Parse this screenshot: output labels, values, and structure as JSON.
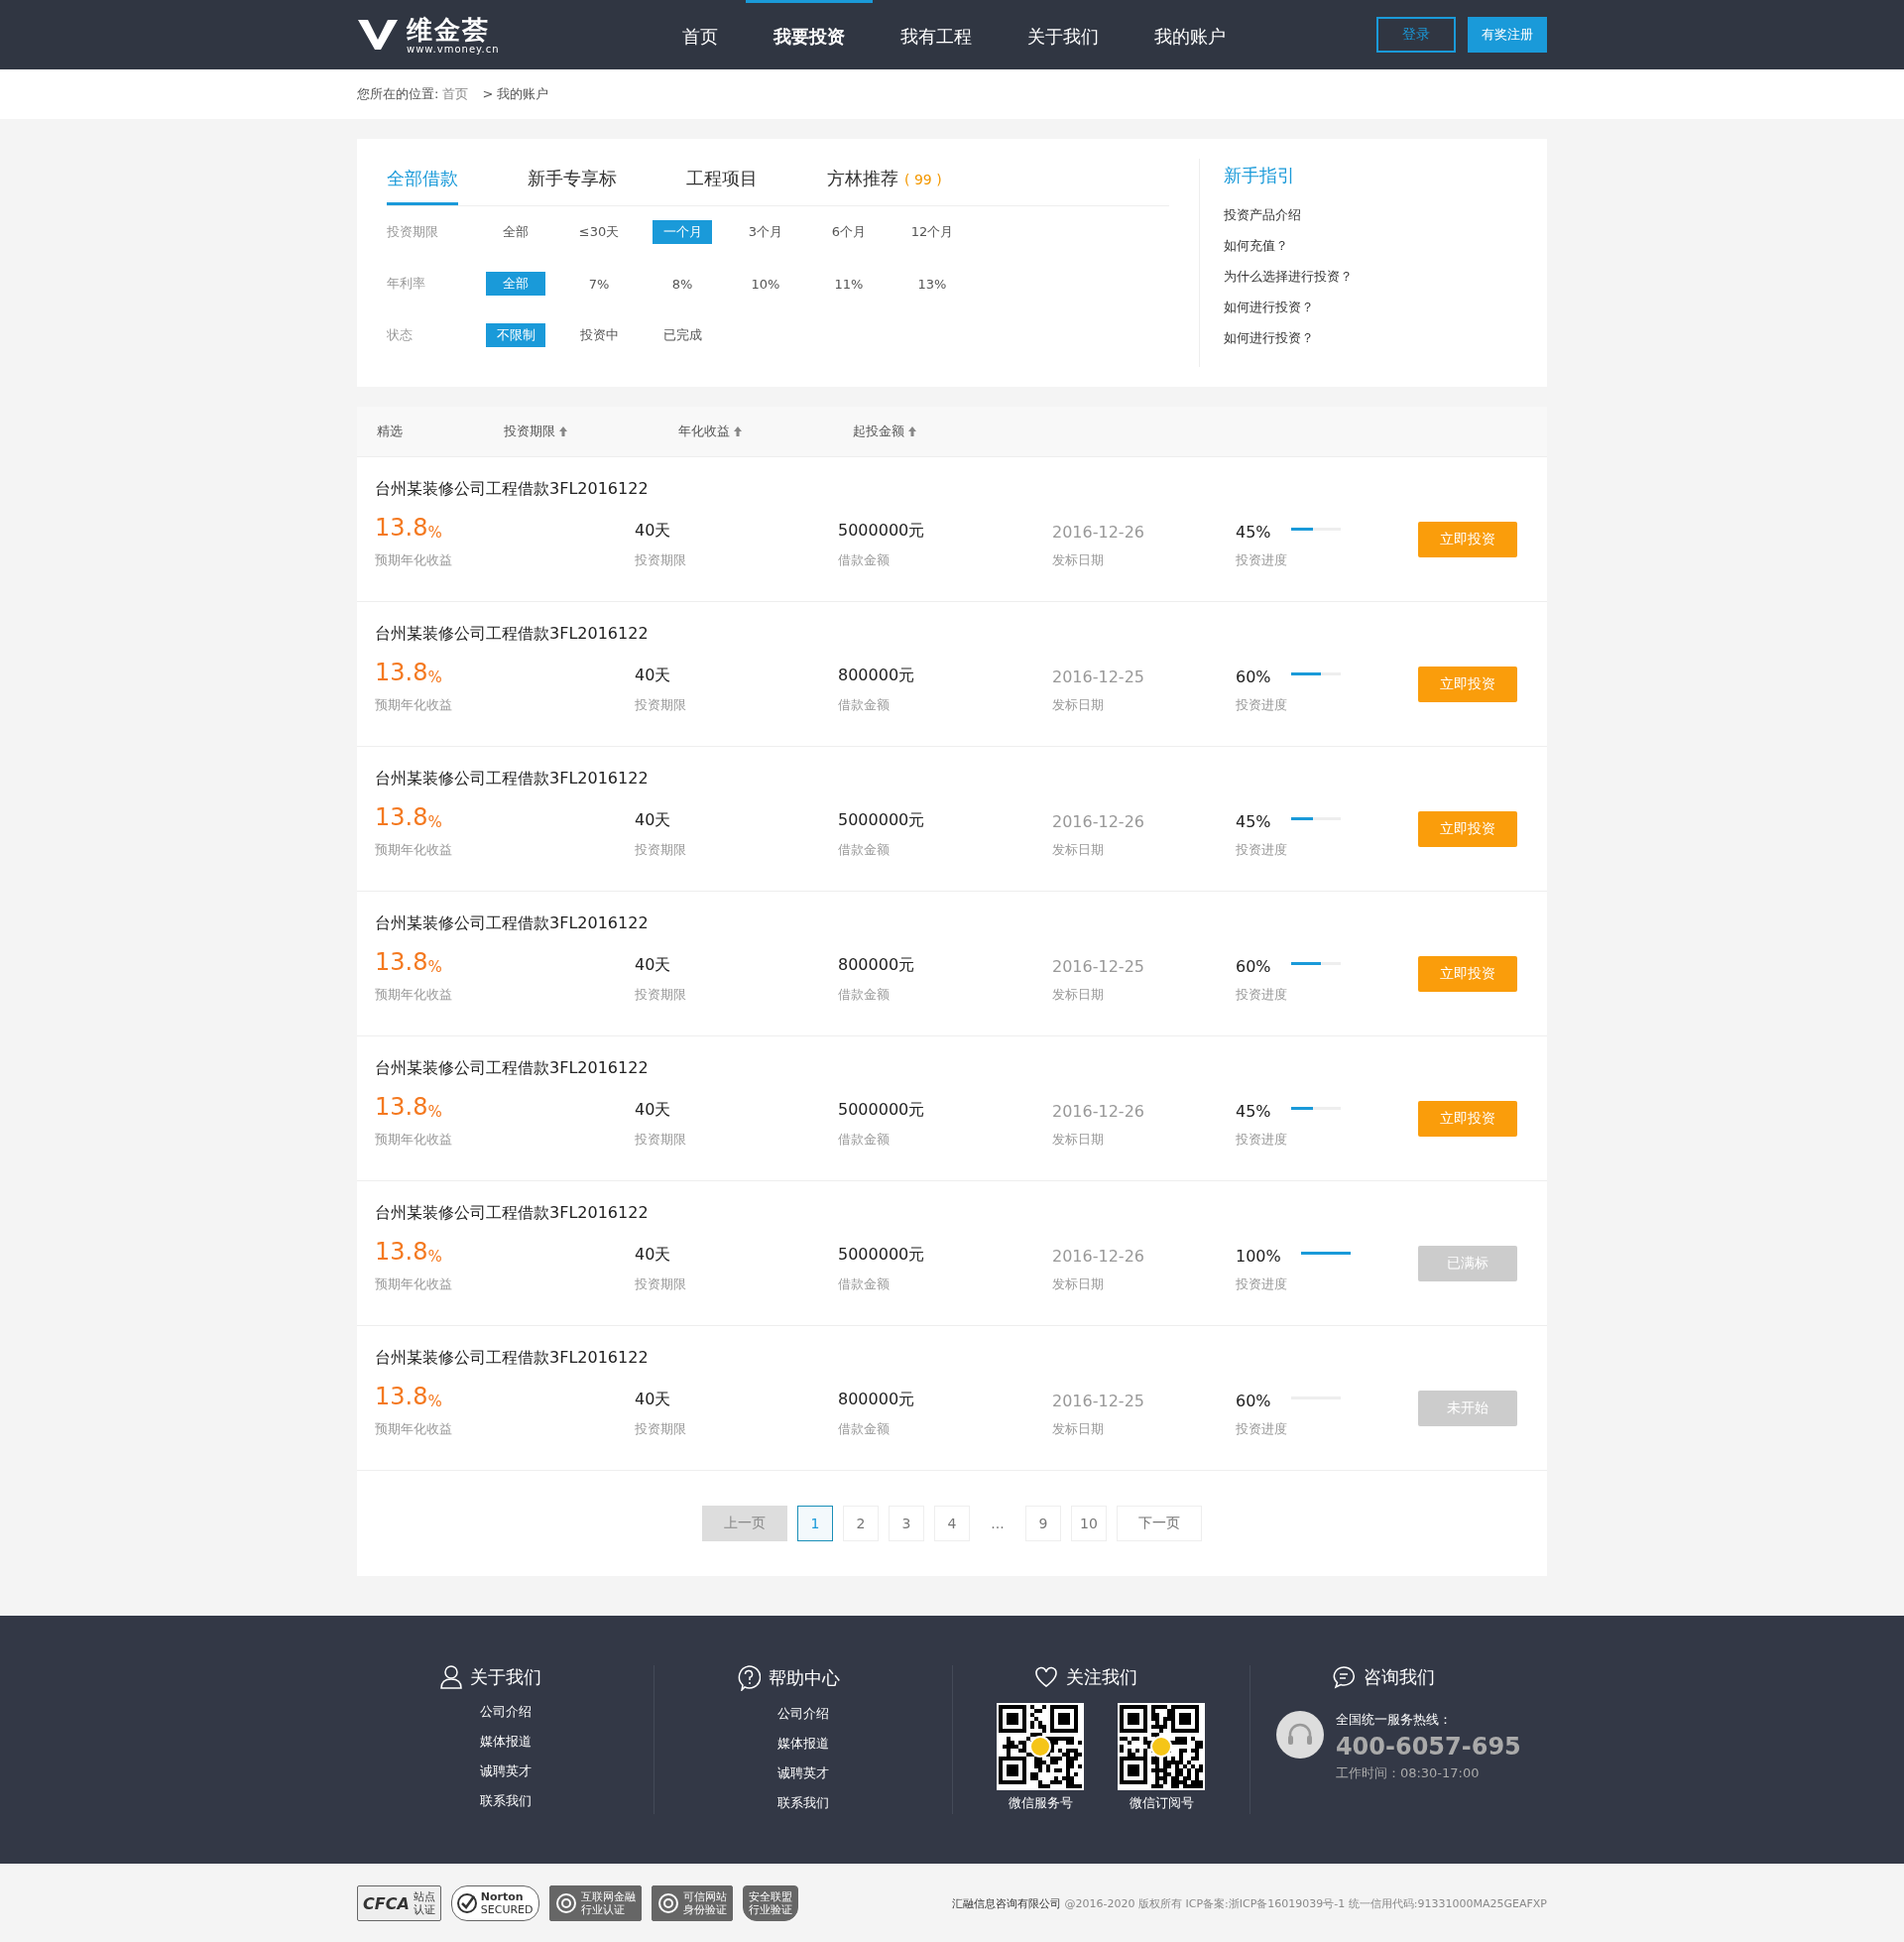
{
  "header": {
    "logo": {
      "name": "维金荟",
      "url": "www.vmoney.cn"
    },
    "nav": [
      {
        "label": "首页",
        "selected": false
      },
      {
        "label": "我要投资",
        "selected": true
      },
      {
        "label": "我有工程",
        "selected": false
      },
      {
        "label": "关于我们",
        "selected": false
      },
      {
        "label": "我的账户",
        "selected": false
      }
    ],
    "login": "登录",
    "register": "有奖注册"
  },
  "breadcrumb": {
    "prefix": "您所在的位置:",
    "home": "首页",
    "current": "> 我的账户"
  },
  "tabs": [
    {
      "label": "全部借款",
      "selected": true
    },
    {
      "label": "新手专享标",
      "selected": false
    },
    {
      "label": "工程项目",
      "selected": false
    },
    {
      "label": "方林推荐",
      "count": "( 99 )",
      "selected": false
    }
  ],
  "filters": [
    {
      "label": "投资期限",
      "options": [
        {
          "label": "全部",
          "selected": false
        },
        {
          "label": "≤30天",
          "selected": false
        },
        {
          "label": "一个月",
          "selected": true
        },
        {
          "label": "3个月",
          "selected": false
        },
        {
          "label": "6个月",
          "selected": false
        },
        {
          "label": "12个月",
          "selected": false
        }
      ]
    },
    {
      "label": "年利率",
      "options": [
        {
          "label": "全部",
          "selected": true
        },
        {
          "label": "7%",
          "selected": false
        },
        {
          "label": "8%",
          "selected": false
        },
        {
          "label": "10%",
          "selected": false
        },
        {
          "label": "11%",
          "selected": false
        },
        {
          "label": "13%",
          "selected": false
        }
      ]
    },
    {
      "label": "状态",
      "options": [
        {
          "label": "不限制",
          "selected": true
        },
        {
          "label": "投资中",
          "selected": false
        },
        {
          "label": "已完成",
          "selected": false
        }
      ]
    }
  ],
  "guide": {
    "title": "新手指引",
    "links": [
      "投资产品介绍",
      "如何充值？",
      "为什么选择进行投资？",
      "如何进行投资？",
      "如何进行投资？"
    ]
  },
  "sort_bar": {
    "first": "精选",
    "columns": [
      "投资期限",
      "年化收益",
      "起投金额"
    ]
  },
  "loans": [
    {
      "title": "台州某装修公司工程借款3FL2016122",
      "rate": "13.8",
      "rate_unit": "%",
      "rate_label": "预期年化收益",
      "term": "40天",
      "term_label": "投资期限",
      "amount": "5000000元",
      "amount_label": "借款金额",
      "date": "2016-12-26",
      "date_label": "发标日期",
      "progress": "45%",
      "level": 0.45,
      "progress_label": "投资进度",
      "button": {
        "label": "立即投资",
        "kind": "open"
      }
    },
    {
      "title": "台州某装修公司工程借款3FL2016122",
      "rate": "13.8",
      "rate_unit": "%",
      "rate_label": "预期年化收益",
      "term": "40天",
      "term_label": "投资期限",
      "amount": "800000元",
      "amount_label": "借款金额",
      "date": "2016-12-25",
      "date_label": "发标日期",
      "progress": "60%",
      "level": 0.6,
      "progress_label": "投资进度",
      "button": {
        "label": "立即投资",
        "kind": "open"
      }
    },
    {
      "title": "台州某装修公司工程借款3FL2016122",
      "rate": "13.8",
      "rate_unit": "%",
      "rate_label": "预期年化收益",
      "term": "40天",
      "term_label": "投资期限",
      "amount": "5000000元",
      "amount_label": "借款金额",
      "date": "2016-12-26",
      "date_label": "发标日期",
      "progress": "45%",
      "level": 0.45,
      "progress_label": "投资进度",
      "button": {
        "label": "立即投资",
        "kind": "open"
      }
    },
    {
      "title": "台州某装修公司工程借款3FL2016122",
      "rate": "13.8",
      "rate_unit": "%",
      "rate_label": "预期年化收益",
      "term": "40天",
      "term_label": "投资期限",
      "amount": "800000元",
      "amount_label": "借款金额",
      "date": "2016-12-25",
      "date_label": "发标日期",
      "progress": "60%",
      "level": 0.6,
      "progress_label": "投资进度",
      "button": {
        "label": "立即投资",
        "kind": "open"
      }
    },
    {
      "title": "台州某装修公司工程借款3FL2016122",
      "rate": "13.8",
      "rate_unit": "%",
      "rate_label": "预期年化收益",
      "term": "40天",
      "term_label": "投资期限",
      "amount": "5000000元",
      "amount_label": "借款金额",
      "date": "2016-12-26",
      "date_label": "发标日期",
      "progress": "45%",
      "level": 0.45,
      "progress_label": "投资进度",
      "button": {
        "label": "立即投资",
        "kind": "open"
      }
    },
    {
      "title": "台州某装修公司工程借款3FL2016122",
      "rate": "13.8",
      "rate_unit": "%",
      "rate_label": "预期年化收益",
      "term": "40天",
      "term_label": "投资期限",
      "amount": "5000000元",
      "amount_label": "借款金额",
      "date": "2016-12-26",
      "date_label": "发标日期",
      "progress": "100%",
      "level": 1.0,
      "progress_label": "投资进度",
      "button": {
        "label": "已满标",
        "kind": "closed"
      }
    },
    {
      "title": "台州某装修公司工程借款3FL2016122",
      "rate": "13.8",
      "rate_unit": "%",
      "rate_label": "预期年化收益",
      "term": "40天",
      "term_label": "投资期限",
      "amount": "800000元",
      "amount_label": "借款金额",
      "date": "2016-12-25",
      "date_label": "发标日期",
      "progress": "60%",
      "progress_label": "投资进度",
      "button": {
        "label": "未开始",
        "kind": "closed"
      }
    }
  ],
  "pagination": {
    "prev": {
      "label": "上一页",
      "disabled": true
    },
    "pages": [
      {
        "label": "1",
        "selected": true
      },
      {
        "label": "2",
        "selected": false
      },
      {
        "label": "3",
        "selected": false
      },
      {
        "label": "4",
        "selected": false
      },
      {
        "label": "...",
        "kind": "gap"
      },
      {
        "label": "9",
        "selected": false
      },
      {
        "label": "10",
        "selected": false
      }
    ],
    "next": {
      "label": "下一页",
      "disabled": false
    }
  },
  "footer": {
    "columns": [
      {
        "kind": "links",
        "title": "关于我们",
        "links": [
          "公司介绍",
          "媒体报道",
          "诚聘英才",
          "联系我们"
        ]
      },
      {
        "kind": "links",
        "title": "帮助中心",
        "links": [
          "公司介绍",
          "媒体报道",
          "诚聘英才",
          "联系我们"
        ]
      },
      {
        "kind": "qr",
        "title": "关注我们",
        "codes": [
          "微信服务号",
          "微信订阅号"
        ]
      },
      {
        "kind": "contact",
        "title": "咨询我们",
        "hotline_label": "全国统一服务热线：",
        "phone": "400-6057-695",
        "hours": "工作时间：08:30-17:00"
      }
    ]
  },
  "bottom": {
    "badges": [
      {
        "kind": "cfca",
        "lines": [
          "CFCA",
          "站点",
          "认证"
        ]
      },
      {
        "kind": "norton",
        "lines": [
          "Norton",
          "SECURED"
        ]
      },
      {
        "kind": "seal",
        "lines": [
          "互联网金融",
          "行业认证"
        ]
      },
      {
        "kind": "ring",
        "lines": [
          "可信网站",
          "身份验证"
        ]
      },
      {
        "kind": "banner",
        "lines": [
          "安全联盟",
          "行业验证"
        ]
      }
    ],
    "company": "汇融信息咨询有限公司",
    "copyright": "@2016-2020 版权所有 ICP备案:浙ICP备16019039号-1 统一信用代码:91331000MA25GEAFXP"
  }
}
